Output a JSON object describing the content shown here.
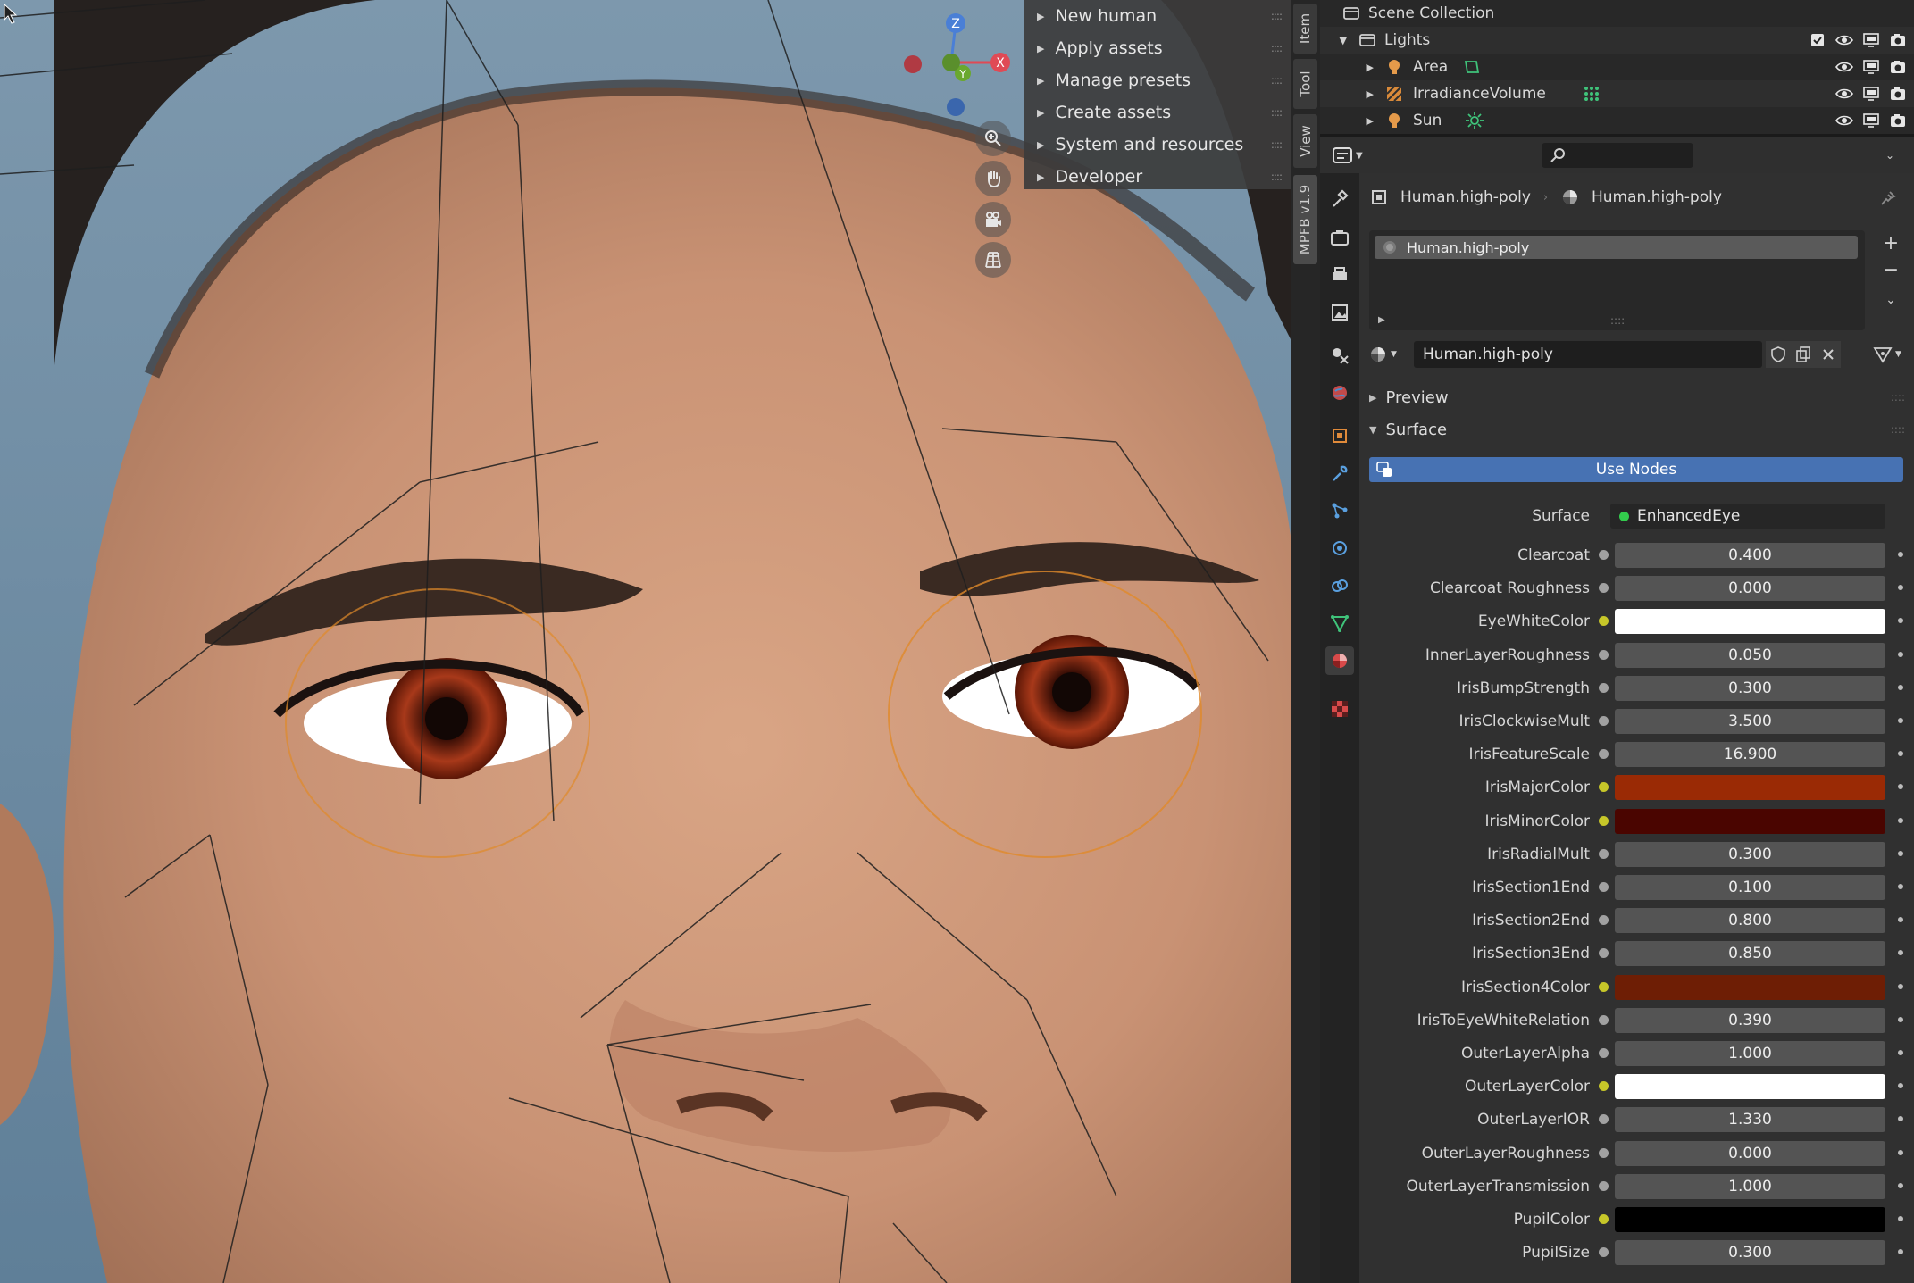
{
  "viewport": {
    "menu_items": [
      {
        "label": "New human"
      },
      {
        "label": "Apply assets"
      },
      {
        "label": "Manage presets"
      },
      {
        "label": "Create assets"
      },
      {
        "label": "System and resources"
      },
      {
        "label": "Developer"
      }
    ],
    "gizmo": {
      "z": "Z",
      "x": "X",
      "y": "Y"
    }
  },
  "sidebar_tabs": [
    "Item",
    "Tool",
    "View",
    "MPFB v1.9"
  ],
  "outliner": {
    "root": "Scene Collection",
    "collection": "Lights",
    "objects": [
      {
        "name": "Area",
        "icon": "area-light-icon"
      },
      {
        "name": "IrradianceVolume",
        "icon": "irradiance-volume-icon"
      },
      {
        "name": "Sun",
        "icon": "sun-light-icon"
      }
    ]
  },
  "properties": {
    "breadcrumb_object": "Human.high-poly",
    "breadcrumb_material": "Human.high-poly",
    "material_slot": "Human.high-poly",
    "material_name": "Human.high-poly",
    "preview_label": "Preview",
    "surface_label": "Surface",
    "use_nodes_label": "Use Nodes",
    "surface_shader": {
      "label": "Surface",
      "value": "EnhancedEye"
    },
    "inputs": [
      {
        "label": "Clearcoat",
        "value": "0.400",
        "type": "value"
      },
      {
        "label": "Clearcoat Roughness",
        "value": "0.000",
        "type": "value"
      },
      {
        "label": "EyeWhiteColor",
        "color": "#ffffff",
        "type": "color"
      },
      {
        "label": "InnerLayerRoughness",
        "value": "0.050",
        "type": "value"
      },
      {
        "label": "IrisBumpStrength",
        "value": "0.300",
        "type": "value"
      },
      {
        "label": "IrisClockwiseMult",
        "value": "3.500",
        "type": "value"
      },
      {
        "label": "IrisFeatureScale",
        "value": "16.900",
        "type": "value"
      },
      {
        "label": "IrisMajorColor",
        "color": "#9a2a05",
        "type": "color"
      },
      {
        "label": "IrisMinorColor",
        "color": "#4a0500",
        "type": "color"
      },
      {
        "label": "IrisRadialMult",
        "value": "0.300",
        "type": "value"
      },
      {
        "label": "IrisSection1End",
        "value": "0.100",
        "type": "value"
      },
      {
        "label": "IrisSection2End",
        "value": "0.800",
        "type": "value"
      },
      {
        "label": "IrisSection3End",
        "value": "0.850",
        "type": "value"
      },
      {
        "label": "IrisSection4Color",
        "color": "#6e1e05",
        "type": "color"
      },
      {
        "label": "IrisToEyeWhiteRelation",
        "value": "0.390",
        "type": "value"
      },
      {
        "label": "OuterLayerAlpha",
        "value": "1.000",
        "type": "value"
      },
      {
        "label": "OuterLayerColor",
        "color": "#ffffff",
        "type": "color"
      },
      {
        "label": "OuterLayerIOR",
        "value": "1.330",
        "type": "value"
      },
      {
        "label": "OuterLayerRoughness",
        "value": "0.000",
        "type": "value"
      },
      {
        "label": "OuterLayerTransmission",
        "value": "1.000",
        "type": "value"
      },
      {
        "label": "PupilColor",
        "color": "#000000",
        "type": "color"
      },
      {
        "label": "PupilSize",
        "value": "0.300",
        "type": "value"
      }
    ]
  },
  "colors": {
    "accent": "#4772b3",
    "selection_outline": "#e08a2a"
  }
}
